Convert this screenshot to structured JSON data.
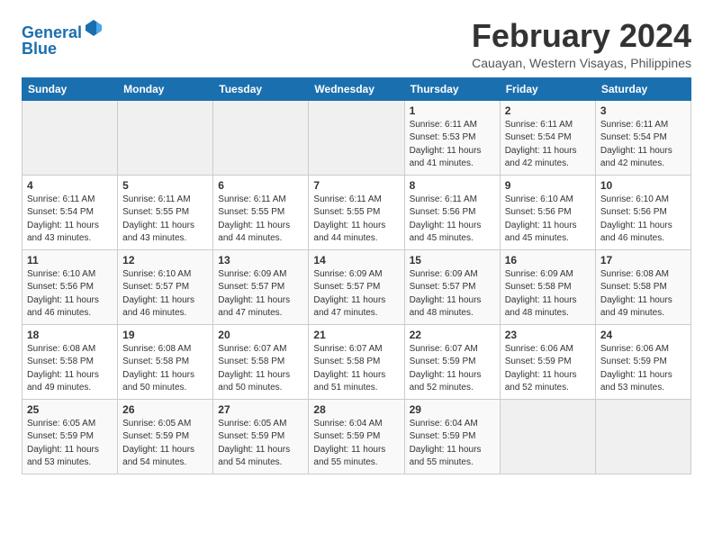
{
  "logo": {
    "text_general": "General",
    "text_blue": "Blue"
  },
  "header": {
    "title": "February 2024",
    "subtitle": "Cauayan, Western Visayas, Philippines"
  },
  "weekdays": [
    "Sunday",
    "Monday",
    "Tuesday",
    "Wednesday",
    "Thursday",
    "Friday",
    "Saturday"
  ],
  "weeks": [
    [
      {
        "day": "",
        "info": ""
      },
      {
        "day": "",
        "info": ""
      },
      {
        "day": "",
        "info": ""
      },
      {
        "day": "",
        "info": ""
      },
      {
        "day": "1",
        "info": "Sunrise: 6:11 AM\nSunset: 5:53 PM\nDaylight: 11 hours and 41 minutes."
      },
      {
        "day": "2",
        "info": "Sunrise: 6:11 AM\nSunset: 5:54 PM\nDaylight: 11 hours and 42 minutes."
      },
      {
        "day": "3",
        "info": "Sunrise: 6:11 AM\nSunset: 5:54 PM\nDaylight: 11 hours and 42 minutes."
      }
    ],
    [
      {
        "day": "4",
        "info": "Sunrise: 6:11 AM\nSunset: 5:54 PM\nDaylight: 11 hours and 43 minutes."
      },
      {
        "day": "5",
        "info": "Sunrise: 6:11 AM\nSunset: 5:55 PM\nDaylight: 11 hours and 43 minutes."
      },
      {
        "day": "6",
        "info": "Sunrise: 6:11 AM\nSunset: 5:55 PM\nDaylight: 11 hours and 44 minutes."
      },
      {
        "day": "7",
        "info": "Sunrise: 6:11 AM\nSunset: 5:55 PM\nDaylight: 11 hours and 44 minutes."
      },
      {
        "day": "8",
        "info": "Sunrise: 6:11 AM\nSunset: 5:56 PM\nDaylight: 11 hours and 45 minutes."
      },
      {
        "day": "9",
        "info": "Sunrise: 6:10 AM\nSunset: 5:56 PM\nDaylight: 11 hours and 45 minutes."
      },
      {
        "day": "10",
        "info": "Sunrise: 6:10 AM\nSunset: 5:56 PM\nDaylight: 11 hours and 46 minutes."
      }
    ],
    [
      {
        "day": "11",
        "info": "Sunrise: 6:10 AM\nSunset: 5:56 PM\nDaylight: 11 hours and 46 minutes."
      },
      {
        "day": "12",
        "info": "Sunrise: 6:10 AM\nSunset: 5:57 PM\nDaylight: 11 hours and 46 minutes."
      },
      {
        "day": "13",
        "info": "Sunrise: 6:09 AM\nSunset: 5:57 PM\nDaylight: 11 hours and 47 minutes."
      },
      {
        "day": "14",
        "info": "Sunrise: 6:09 AM\nSunset: 5:57 PM\nDaylight: 11 hours and 47 minutes."
      },
      {
        "day": "15",
        "info": "Sunrise: 6:09 AM\nSunset: 5:57 PM\nDaylight: 11 hours and 48 minutes."
      },
      {
        "day": "16",
        "info": "Sunrise: 6:09 AM\nSunset: 5:58 PM\nDaylight: 11 hours and 48 minutes."
      },
      {
        "day": "17",
        "info": "Sunrise: 6:08 AM\nSunset: 5:58 PM\nDaylight: 11 hours and 49 minutes."
      }
    ],
    [
      {
        "day": "18",
        "info": "Sunrise: 6:08 AM\nSunset: 5:58 PM\nDaylight: 11 hours and 49 minutes."
      },
      {
        "day": "19",
        "info": "Sunrise: 6:08 AM\nSunset: 5:58 PM\nDaylight: 11 hours and 50 minutes."
      },
      {
        "day": "20",
        "info": "Sunrise: 6:07 AM\nSunset: 5:58 PM\nDaylight: 11 hours and 50 minutes."
      },
      {
        "day": "21",
        "info": "Sunrise: 6:07 AM\nSunset: 5:58 PM\nDaylight: 11 hours and 51 minutes."
      },
      {
        "day": "22",
        "info": "Sunrise: 6:07 AM\nSunset: 5:59 PM\nDaylight: 11 hours and 52 minutes."
      },
      {
        "day": "23",
        "info": "Sunrise: 6:06 AM\nSunset: 5:59 PM\nDaylight: 11 hours and 52 minutes."
      },
      {
        "day": "24",
        "info": "Sunrise: 6:06 AM\nSunset: 5:59 PM\nDaylight: 11 hours and 53 minutes."
      }
    ],
    [
      {
        "day": "25",
        "info": "Sunrise: 6:05 AM\nSunset: 5:59 PM\nDaylight: 11 hours and 53 minutes."
      },
      {
        "day": "26",
        "info": "Sunrise: 6:05 AM\nSunset: 5:59 PM\nDaylight: 11 hours and 54 minutes."
      },
      {
        "day": "27",
        "info": "Sunrise: 6:05 AM\nSunset: 5:59 PM\nDaylight: 11 hours and 54 minutes."
      },
      {
        "day": "28",
        "info": "Sunrise: 6:04 AM\nSunset: 5:59 PM\nDaylight: 11 hours and 55 minutes."
      },
      {
        "day": "29",
        "info": "Sunrise: 6:04 AM\nSunset: 5:59 PM\nDaylight: 11 hours and 55 minutes."
      },
      {
        "day": "",
        "info": ""
      },
      {
        "day": "",
        "info": ""
      }
    ]
  ]
}
